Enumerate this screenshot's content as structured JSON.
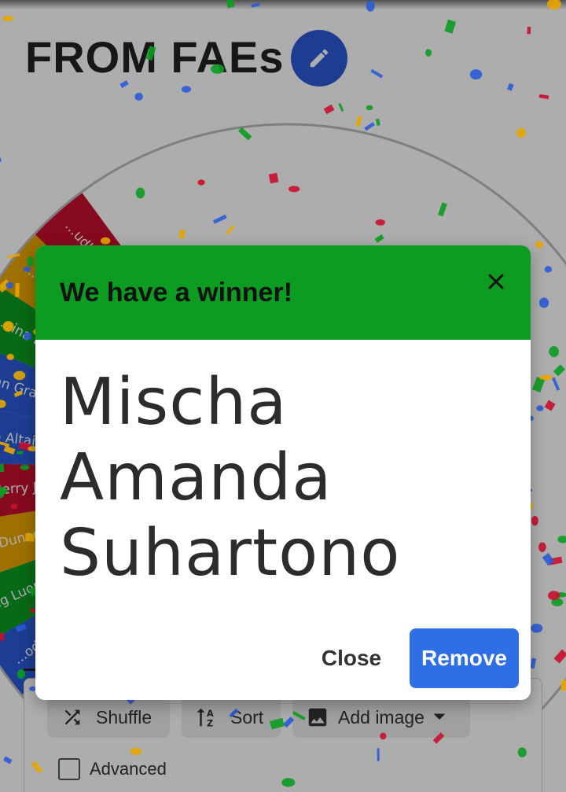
{
  "page": {
    "title": "FROM FAEs"
  },
  "wheel": {
    "segments": [
      {
        "label": "...oda",
        "color": "#2a5bd7"
      },
      {
        "label": "Jing Luong",
        "color": "#0b9c21"
      },
      {
        "label": "...ng Dunan Gess...",
        "color": "#e8a500"
      },
      {
        "label": "Nazia Jerry Jere...",
        "color": "#c8102e"
      },
      {
        "label": "Adrian Altair",
        "color": "#2a5bd7"
      },
      {
        "label": "Vivian Grace",
        "color": "#2a5bd7"
      },
      {
        "label": "...eina Ivony Hir...",
        "color": "#0b9c21"
      },
      {
        "label": "...an Aldebra...",
        "color": "#e8a500"
      },
      {
        "label": "...udhi...",
        "color": "#c8102e"
      }
    ]
  },
  "dialog": {
    "title": "We have a winner!",
    "winner": [
      "Mischa",
      "Amanda",
      "Suhartono"
    ],
    "close_label": "Close",
    "remove_label": "Remove",
    "header_color": "#0b9c21",
    "accent_color": "#2f6fe5"
  },
  "toolbar": {
    "shuffle_label": "Shuffle",
    "sort_label": "Sort",
    "add_image_label": "Add image",
    "advanced_label": "Advanced"
  },
  "icons": {
    "edit": "pencil-icon",
    "close": "close-icon",
    "shuffle": "shuffle-icon",
    "sort": "sort-az-icon",
    "image": "image-icon",
    "dropdown": "caret-down-icon"
  }
}
